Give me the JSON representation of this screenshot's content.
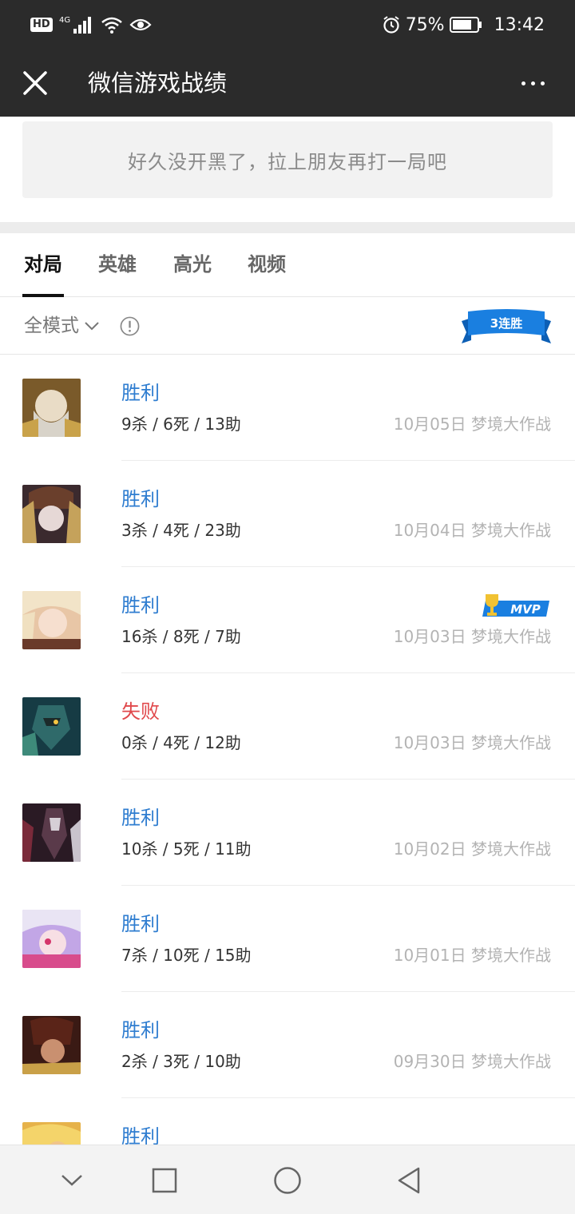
{
  "status_bar": {
    "left_badge": "HD",
    "network": "4G",
    "battery": "75%",
    "time": "13:42",
    "icons": [
      "signal-icon",
      "wifi-icon",
      "eye-icon",
      "alarm-icon",
      "battery-icon"
    ]
  },
  "app_bar": {
    "title": "微信游戏战绩",
    "close_icon": "close-icon",
    "more_icon": "more-icon"
  },
  "banner": {
    "text": "好久没开黑了，拉上朋友再打一局吧"
  },
  "tabs": [
    {
      "label": "对局",
      "active": true
    },
    {
      "label": "英雄",
      "active": false
    },
    {
      "label": "高光",
      "active": false
    },
    {
      "label": "视频",
      "active": false
    }
  ],
  "filter": {
    "mode_label": "全模式",
    "streak_label": "3连胜"
  },
  "matches": [
    {
      "result": "胜利",
      "outcome": "win",
      "kda": "9杀 / 6死 / 13助",
      "meta": "10月05日 梦境大作战",
      "mvp": false
    },
    {
      "result": "胜利",
      "outcome": "win",
      "kda": "3杀 / 4死 / 23助",
      "meta": "10月04日 梦境大作战",
      "mvp": false
    },
    {
      "result": "胜利",
      "outcome": "win",
      "kda": "16杀 / 8死 / 7助",
      "meta": "10月03日 梦境大作战",
      "mvp": true,
      "mvp_label": "MVP"
    },
    {
      "result": "失败",
      "outcome": "lose",
      "kda": "0杀 / 4死 / 12助",
      "meta": "10月03日 梦境大作战",
      "mvp": false
    },
    {
      "result": "胜利",
      "outcome": "win",
      "kda": "10杀 / 5死 / 11助",
      "meta": "10月02日 梦境大作战",
      "mvp": false
    },
    {
      "result": "胜利",
      "outcome": "win",
      "kda": "7杀 / 10死 / 15助",
      "meta": "10月01日 梦境大作战",
      "mvp": false
    },
    {
      "result": "胜利",
      "outcome": "win",
      "kda": "2杀 / 3死 / 10助",
      "meta": "09月30日 梦境大作战",
      "mvp": false
    },
    {
      "result": "胜利",
      "outcome": "win",
      "kda": "",
      "meta": "",
      "mvp": false
    }
  ],
  "nav_bar": {
    "icons": [
      "collapse-icon",
      "recents-icon",
      "home-icon",
      "back-icon"
    ]
  },
  "colors": {
    "bar_bg": "#2b2b2b",
    "win": "#2f7dd0",
    "lose": "#e0484b",
    "badge_blue": "#1a7fe0",
    "trophy_gold": "#f1c232"
  }
}
